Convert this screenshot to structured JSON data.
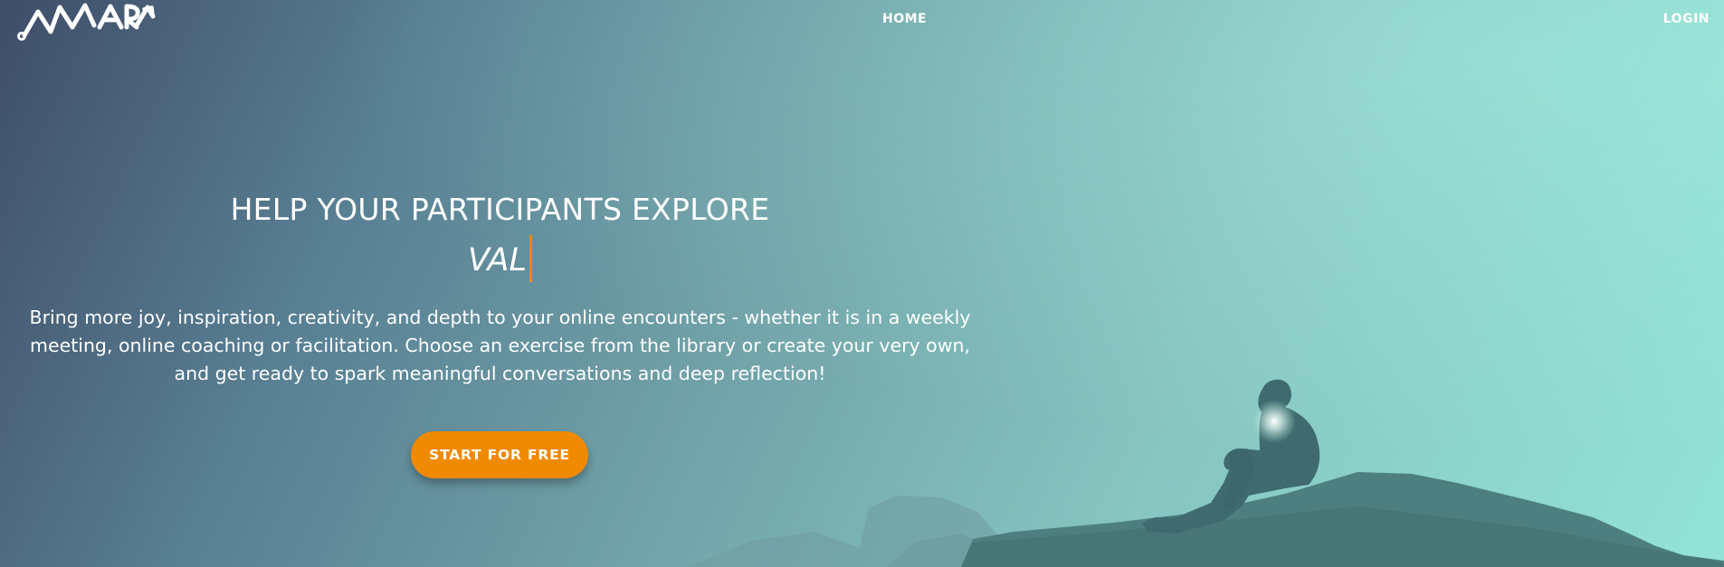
{
  "brand": {
    "logo_text": "AMARA"
  },
  "nav": {
    "home": "HOME",
    "login": "LOGIN"
  },
  "hero": {
    "headline": "HELP YOUR PARTICIPANTS EXPLORE",
    "typed_word": "VAL",
    "description": "Bring more joy, inspiration, creativity, and depth to your online encounters - whether it is in a weekly meeting, online coaching or facilitation. Choose an exercise from the library or create your very own, and get ready to spark meaningful conversations and deep reflection!",
    "cta_label": "START FOR FREE"
  },
  "colors": {
    "accent": "#f08a00",
    "gradient_start": "#3f4d68",
    "gradient_end": "#93e4d8",
    "text": "#ffffff"
  }
}
